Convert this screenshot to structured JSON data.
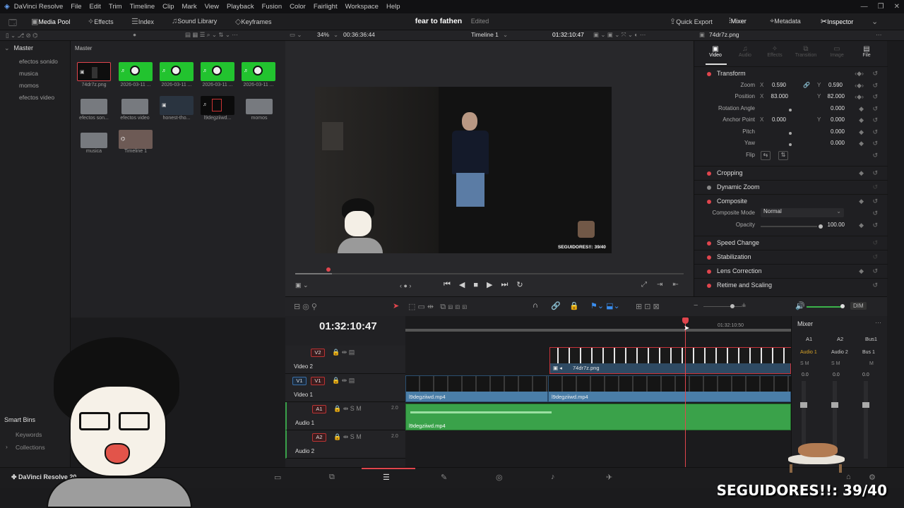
{
  "app": {
    "name": "DaVinci Resolve",
    "menu": [
      "File",
      "Edit",
      "Trim",
      "Timeline",
      "Clip",
      "Mark",
      "View",
      "Playback",
      "Fusion",
      "Color",
      "Fairlight",
      "Workspace",
      "Help"
    ],
    "project_title": "fear to fathen",
    "project_status": "Edited"
  },
  "toolbar": {
    "media_pool": "Media Pool",
    "effects": "Effects",
    "index": "Index",
    "sound_library": "Sound Library",
    "keyframes": "Keyframes",
    "quick_export": "Quick Export",
    "mixer": "Mixer",
    "metadata": "Metadata",
    "inspector": "Inspector"
  },
  "viewer_bar": {
    "zoom": "34%",
    "duration": "00:36:36:44",
    "timeline_name": "Timeline 1",
    "timecode": "01:32:10:47",
    "clip_name": "74dr7z.png"
  },
  "bins": {
    "root": "Master",
    "items": [
      "efectos sonido",
      "musica",
      "momos",
      "efectos video"
    ],
    "smart_bins_title": "Smart Bins",
    "smart_items": [
      "Keywords",
      "Collections"
    ]
  },
  "media_pool": {
    "header": "Master",
    "clips": [
      {
        "label": "74dr7z.png",
        "kind": "image"
      },
      {
        "label": "2026-03-11 ...",
        "kind": "green"
      },
      {
        "label": "2026-03-11 ...",
        "kind": "green"
      },
      {
        "label": "2026-03-11 ...",
        "kind": "green"
      },
      {
        "label": "2026-03-11 ...",
        "kind": "green"
      },
      {
        "label": "efectos son...",
        "kind": "folder"
      },
      {
        "label": "efectos video",
        "kind": "folder"
      },
      {
        "label": "honest-tho...",
        "kind": "video"
      },
      {
        "label": "l9degziiwd...",
        "kind": "video"
      },
      {
        "label": "momos",
        "kind": "folder"
      },
      {
        "label": "musica",
        "kind": "folder"
      },
      {
        "label": "Timeline 1",
        "kind": "timeline"
      }
    ]
  },
  "video_overlay": {
    "seguidores": "SEGUIDORES!!: 39/40"
  },
  "inspector": {
    "tabs": [
      "Video",
      "Audio",
      "Effects",
      "Transition",
      "Image",
      "File"
    ],
    "transform_title": "Transform",
    "zoom_label": "Zoom",
    "zoom_x": "0.590",
    "zoom_y": "0.590",
    "position_label": "Position",
    "position_x": "83.000",
    "position_y": "82.000",
    "rotation_label": "Rotation Angle",
    "rotation": "0.000",
    "anchor_label": "Anchor Point",
    "anchor_x": "0.000",
    "anchor_y": "0.000",
    "pitch_label": "Pitch",
    "pitch": "0.000",
    "yaw_label": "Yaw",
    "yaw": "0.000",
    "flip_label": "Flip",
    "x": "X",
    "y": "Y",
    "cropping": "Cropping",
    "dynamic_zoom": "Dynamic Zoom",
    "composite": "Composite",
    "composite_mode_label": "Composite Mode",
    "composite_mode": "Normal",
    "opacity_label": "Opacity",
    "opacity": "100.00",
    "speed_change": "Speed Change",
    "stabilization": "Stabilization",
    "lens_correction": "Lens Correction",
    "retime": "Retime and Scaling"
  },
  "timeline": {
    "timecode": "01:32:10:47",
    "ruler_tc": "01:32:10:50",
    "tracks": [
      {
        "tag": "V2",
        "name": "Video 2"
      },
      {
        "tag": "V1",
        "name": "Video 1"
      },
      {
        "tag": "A1",
        "name": "Audio 1",
        "level": "2.0"
      },
      {
        "tag": "A2",
        "name": "Audio 2",
        "level": "2.0"
      }
    ],
    "clip_v2": "74dr7z.png",
    "clip_v1a": "l9degziiwd.mp4",
    "clip_v1b": "l9degziiwd.mp4",
    "clip_a1": "l9degziiwd.mp4",
    "dim": "DIM"
  },
  "mixer": {
    "title": "Mixer",
    "cols": [
      "A1",
      "A2",
      "Bus1"
    ],
    "names": [
      "Audio 1",
      "Audio 2",
      "Bus 1"
    ],
    "level": "0.0"
  },
  "bottom": {
    "app_label": "DaVinci Resolve 20"
  },
  "stream_overlay": "SEGUIDORES!!: 39/40",
  "colors": {
    "accent_red": "#e0454d",
    "clip_blue": "#4a7ea8",
    "clip_green": "#3aa24a",
    "selection_red": "#c8323a"
  }
}
